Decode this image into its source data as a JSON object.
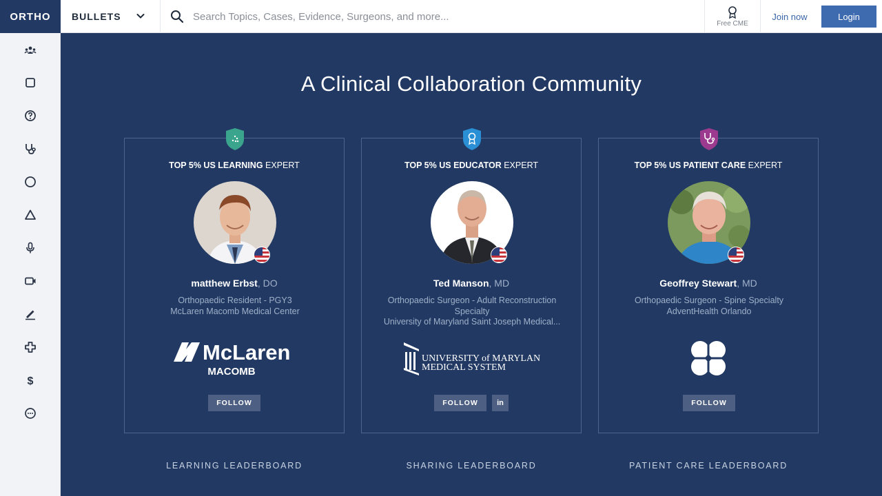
{
  "topbar": {
    "logo": "ORTHO",
    "product": "BULLETS",
    "search_placeholder": "Search Topics, Cases, Evidence, Surgeons, and more...",
    "cme_label": "Free CME",
    "join_label": "Join now",
    "login_label": "Login"
  },
  "sidebar": {
    "icons": [
      "community-icon",
      "topics-square-icon",
      "help-question-icon",
      "stethoscope-icon",
      "circle-icon",
      "triangle-icon",
      "microphone-icon",
      "video-camera-icon",
      "pen-icon",
      "cross-plus-icon",
      "dollar-icon",
      "chat-bubble-icon"
    ]
  },
  "main": {
    "headline": "A Clinical Collaboration Community",
    "cards": [
      {
        "title_bold": "TOP 5% US LEARNING",
        "title_rest": " EXPERT",
        "name": "matthew Erbst",
        "credential": ", DO",
        "role_lines": [
          "Orthopaedic Resident - PGY3",
          "McLaren Macomb Medical Center"
        ],
        "institution_name": "McLaren",
        "institution_sub": "MACOMB",
        "follow_label": "FOLLOW",
        "badge_color": "#3aa58c"
      },
      {
        "title_bold": "TOP 5% US EDUCATOR",
        "title_rest": " EXPERT",
        "name": "Ted Manson",
        "credential": ", MD",
        "role_lines": [
          "Orthopaedic Surgeon - Adult Reconstruction",
          "Specialty",
          "University of Maryland Saint Joseph Medical..."
        ],
        "institution_line1": "UNIVERSITY of MARYLAND",
        "institution_line2": "MEDICAL SYSTEM",
        "follow_label": "FOLLOW",
        "linkedin_label": "in",
        "badge_color": "#2b8fd6"
      },
      {
        "title_bold": "TOP 5% US PATIENT CARE",
        "title_rest": " EXPERT",
        "name": "Geoffrey Stewart",
        "credential": ", MD",
        "role_lines": [
          "Orthopaedic Surgeon - Spine Specialty",
          "AdventHealth Orlando"
        ],
        "follow_label": "FOLLOW",
        "badge_color": "#9b3a8e"
      }
    ],
    "leaderboards": [
      "LEARNING LEADERBOARD",
      "SHARING LEADERBOARD",
      "PATIENT CARE LEADERBOARD"
    ]
  }
}
